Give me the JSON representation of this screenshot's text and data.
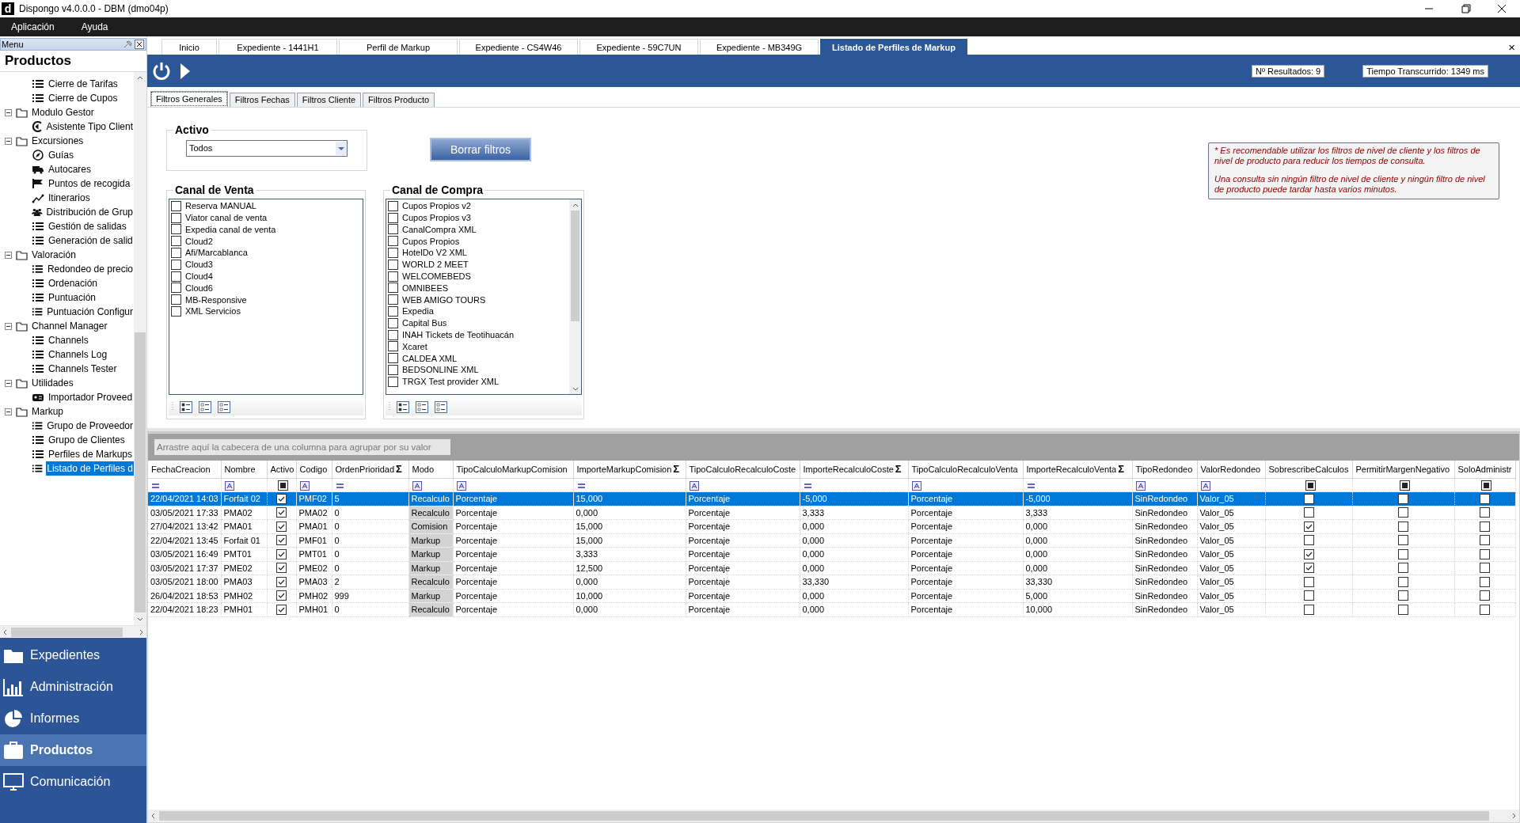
{
  "window": {
    "logo": "d",
    "title": "Dispongo v4.0.0.0 - DBM (dmo04p)"
  },
  "menu_bar": [
    "Aplicación",
    "Ayuda"
  ],
  "sidebar": {
    "header": "Menu",
    "section_title": "Productos",
    "tree": [
      {
        "kind": "list",
        "label": "Cierre de Tarifas",
        "selected": false
      },
      {
        "kind": "list",
        "label": "Cierre de Cupos",
        "selected": false
      },
      {
        "kind": "folder",
        "label": "Modulo Gestor",
        "expanded": true,
        "children": [
          {
            "kind": "wizard",
            "label": "Asistente Tipo Client",
            "selected": false
          }
        ]
      },
      {
        "kind": "folder",
        "label": "Excursiones",
        "expanded": true,
        "children": [
          {
            "kind": "compass",
            "label": "Guías",
            "selected": false
          },
          {
            "kind": "truck",
            "label": "Autocares",
            "selected": false
          },
          {
            "kind": "flag",
            "label": "Puntos de recogida",
            "selected": false
          },
          {
            "kind": "route",
            "label": "Itinerarios",
            "selected": false
          },
          {
            "kind": "group",
            "label": "Distribución de Grup",
            "selected": false
          },
          {
            "kind": "list",
            "label": "Gestión de salidas",
            "selected": false
          },
          {
            "kind": "list",
            "label": "Generación de salid",
            "selected": false
          }
        ]
      },
      {
        "kind": "folder",
        "label": "Valoración",
        "expanded": true,
        "children": [
          {
            "kind": "list",
            "label": "Redondeo de precio",
            "selected": false
          },
          {
            "kind": "list",
            "label": "Ordenación",
            "selected": false
          },
          {
            "kind": "list",
            "label": "Puntuación",
            "selected": false
          },
          {
            "kind": "list",
            "label": "Puntuación Configur",
            "selected": false
          }
        ]
      },
      {
        "kind": "folder",
        "label": "Channel Manager",
        "expanded": true,
        "children": [
          {
            "kind": "list",
            "label": "Channels",
            "selected": false
          },
          {
            "kind": "list",
            "label": "Channels Log",
            "selected": false
          },
          {
            "kind": "list",
            "label": "Channels Tester",
            "selected": false
          }
        ]
      },
      {
        "kind": "folder",
        "label": "Utilidades",
        "expanded": true,
        "children": [
          {
            "kind": "card",
            "label": "Importador Proveed",
            "selected": false
          }
        ]
      },
      {
        "kind": "folder",
        "label": "Markup",
        "expanded": true,
        "children": [
          {
            "kind": "list",
            "label": "Grupo de Proveedor",
            "selected": false
          },
          {
            "kind": "list",
            "label": "Grupo de Clientes",
            "selected": false
          },
          {
            "kind": "list",
            "label": "Perfiles de Markups",
            "selected": false
          },
          {
            "kind": "list",
            "label": "Listado de Perfiles d",
            "selected": true
          }
        ]
      }
    ],
    "nav": [
      {
        "kind": "folder",
        "label": "Expedientes",
        "selected": false
      },
      {
        "kind": "chart",
        "label": "Administración",
        "selected": false
      },
      {
        "kind": "pie",
        "label": "Informes",
        "selected": false
      },
      {
        "kind": "briefcase",
        "label": "Productos",
        "selected": true
      },
      {
        "kind": "monitor",
        "label": "Comunicación",
        "selected": false
      }
    ]
  },
  "document_tabs": [
    {
      "label": "Inicio",
      "selected": false
    },
    {
      "label": "Expediente - 1441H1",
      "selected": false
    },
    {
      "label": "Perfil de Markup",
      "selected": false
    },
    {
      "label": "Expediente - CS4W46",
      "selected": false
    },
    {
      "label": "Expediente - 59C7UN",
      "selected": false
    },
    {
      "label": "Expediente - MB349G",
      "selected": false
    },
    {
      "label": "Listado de Perfiles de Markup",
      "selected": true
    }
  ],
  "tabs_close": "×",
  "toolbar": {
    "results": "Nº Resultados: 9",
    "elapsed": "Tiempo Transcurrido: 1349 ms"
  },
  "filter_tabs": [
    {
      "label": "Filtros Generales",
      "selected": true
    },
    {
      "label": "Filtros Fechas",
      "selected": false
    },
    {
      "label": "Filtros Cliente",
      "selected": false
    },
    {
      "label": "Filtros Producto",
      "selected": false
    }
  ],
  "activo": {
    "title": "Activo",
    "value": "Todos"
  },
  "clear_button": "Borrar filtros",
  "canal_venta": {
    "title": "Canal de Venta",
    "items": [
      {
        "label": "Reserva MANUAL",
        "checked": false
      },
      {
        "label": "Viator canal de venta",
        "checked": false
      },
      {
        "label": "Expedia canal de venta",
        "checked": false
      },
      {
        "label": "Cloud2",
        "checked": false
      },
      {
        "label": "Afi/Marcablanca",
        "checked": false
      },
      {
        "label": "Cloud3",
        "checked": false
      },
      {
        "label": "Cloud4",
        "checked": false
      },
      {
        "label": "Cloud6",
        "checked": false
      },
      {
        "label": "MB-Responsive",
        "checked": false
      },
      {
        "label": "XML Servicios",
        "checked": false
      }
    ]
  },
  "canal_compra": {
    "title": "Canal de Compra",
    "items": [
      {
        "label": "Cupos Propios v2",
        "checked": false
      },
      {
        "label": "Cupos Propios v3",
        "checked": false
      },
      {
        "label": "CanalCompra XML",
        "checked": false
      },
      {
        "label": "Cupos Propios",
        "checked": false
      },
      {
        "label": "HotelDo V2 XML",
        "checked": false
      },
      {
        "label": "WORLD 2 MEET",
        "checked": false
      },
      {
        "label": "WELCOMEBEDS",
        "checked": false
      },
      {
        "label": "OMNIBEES",
        "checked": false
      },
      {
        "label": "WEB AMIGO TOURS",
        "checked": false
      },
      {
        "label": "Expedia",
        "checked": false
      },
      {
        "label": "Capital Bus",
        "checked": false
      },
      {
        "label": "INAH Tickets de Teotihuacán",
        "checked": false
      },
      {
        "label": "Xcaret",
        "checked": false
      },
      {
        "label": "CALDEA XML",
        "checked": false
      },
      {
        "label": "BEDSONLINE XML",
        "checked": false
      },
      {
        "label": "TRGX Test provider XML",
        "checked": false
      }
    ]
  },
  "note": [
    "* Es recomendable utilizar los filtros de nivel de cliente y los filtros de nivel de producto para reducir los tiempos de consulta.",
    "Una consulta sin ningún filtro de nivel de cliente y ningún filtro de nivel de producto puede tardar hasta varios minutos."
  ],
  "grid": {
    "group_hint": "Arrastre aquí la cabecera de una columna para agrupar por su valor",
    "columns": [
      {
        "label": "FechaCreacion",
        "kind": "date"
      },
      {
        "label": "Nombre",
        "kind": "text"
      },
      {
        "label": "Activo",
        "kind": "check"
      },
      {
        "label": "Codigo",
        "kind": "text"
      },
      {
        "label": "OrdenPrioridad",
        "kind": "number",
        "sum_mark": "Σ"
      },
      {
        "label": "Modo",
        "kind": "text",
        "shaded": true
      },
      {
        "label": "TipoCalculoMarkupComision",
        "kind": "text"
      },
      {
        "label": "ImporteMarkupComision",
        "kind": "number",
        "sum_mark": "Σ"
      },
      {
        "label": "TipoCalculoRecalculoCoste",
        "kind": "text"
      },
      {
        "label": "ImporteRecalculoCoste",
        "kind": "number",
        "sum_mark": "Σ"
      },
      {
        "label": "TipoCalculoRecalculoVenta",
        "kind": "text"
      },
      {
        "label": "ImporteRecalculoVenta",
        "kind": "number",
        "sum_mark": "Σ"
      },
      {
        "label": "TipoRedondeo",
        "kind": "text"
      },
      {
        "label": "ValorRedondeo",
        "kind": "text"
      },
      {
        "label": "SobrescribeCalculos",
        "kind": "check"
      },
      {
        "label": "PermitirMargenNegativo",
        "kind": "check"
      },
      {
        "label": "SoloAdministr",
        "kind": "check"
      }
    ],
    "rows": [
      {
        "selected": true,
        "cells": [
          "22/04/2021 14:03",
          "Forfait 02",
          true,
          "PMF02",
          "5",
          "Recalculo",
          "Porcentaje",
          "15,000",
          "Porcentaje",
          "-5,000",
          "Porcentaje",
          "-5,000",
          "SinRedondeo",
          "Valor_05",
          false,
          false,
          false
        ]
      },
      {
        "selected": false,
        "cells": [
          "03/05/2021 17:33",
          "PMA02",
          true,
          "PMA02",
          "0",
          "Recalculo",
          "Porcentaje",
          "0,000",
          "Porcentaje",
          "3,333",
          "Porcentaje",
          "3,333",
          "SinRedondeo",
          "Valor_05",
          false,
          false,
          false
        ]
      },
      {
        "selected": false,
        "cells": [
          "27/04/2021 13:42",
          "PMA01",
          true,
          "PMA01",
          "0",
          "Comision",
          "Porcentaje",
          "15,000",
          "Porcentaje",
          "0,000",
          "Porcentaje",
          "0,000",
          "SinRedondeo",
          "Valor_05",
          true,
          false,
          false
        ]
      },
      {
        "selected": false,
        "cells": [
          "22/04/2021 13:45",
          "Forfait 01",
          true,
          "PMF01",
          "0",
          "Markup",
          "Porcentaje",
          "15,000",
          "Porcentaje",
          "0,000",
          "Porcentaje",
          "0,000",
          "SinRedondeo",
          "Valor_05",
          false,
          false,
          false
        ]
      },
      {
        "selected": false,
        "cells": [
          "03/05/2021 16:49",
          "PMT01",
          true,
          "PMT01",
          "0",
          "Markup",
          "Porcentaje",
          "3,333",
          "Porcentaje",
          "0,000",
          "Porcentaje",
          "0,000",
          "SinRedondeo",
          "Valor_05",
          true,
          false,
          false
        ]
      },
      {
        "selected": false,
        "cells": [
          "03/05/2021 17:37",
          "PME02",
          true,
          "PME02",
          "0",
          "Markup",
          "Porcentaje",
          "12,500",
          "Porcentaje",
          "0,000",
          "Porcentaje",
          "0,000",
          "SinRedondeo",
          "Valor_05",
          true,
          false,
          false
        ]
      },
      {
        "selected": false,
        "cells": [
          "03/05/2021 18:00",
          "PMA03",
          true,
          "PMA03",
          "2",
          "Recalculo",
          "Porcentaje",
          "0,000",
          "Porcentaje",
          "33,330",
          "Porcentaje",
          "33,330",
          "SinRedondeo",
          "Valor_05",
          false,
          false,
          false
        ]
      },
      {
        "selected": false,
        "cells": [
          "26/04/2021 18:53",
          "PMH02",
          true,
          "PMH02",
          "999",
          "Markup",
          "Porcentaje",
          "10,000",
          "Porcentaje",
          "0,000",
          "Porcentaje",
          "5,000",
          "SinRedondeo",
          "Valor_05",
          false,
          false,
          false
        ]
      },
      {
        "selected": false,
        "cells": [
          "22/04/2021 18:23",
          "PMH01",
          true,
          "PMH01",
          "0",
          "Recalculo",
          "Porcentaje",
          "0,000",
          "Porcentaje",
          "0,000",
          "Porcentaje",
          "10,000",
          "SinRedondeo",
          "Valor_05",
          false,
          false,
          false
        ]
      }
    ]
  }
}
